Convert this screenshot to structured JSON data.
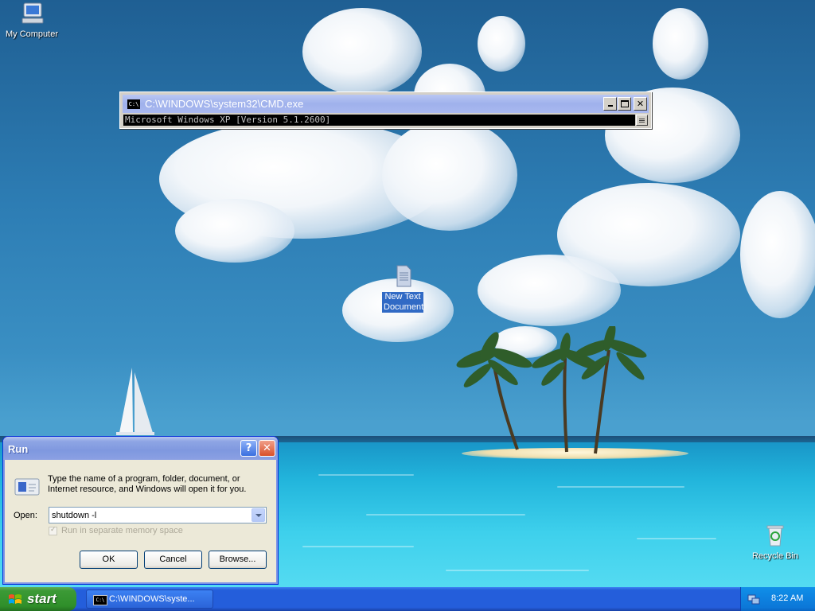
{
  "desktop": {
    "icons": [
      {
        "label": "My Computer",
        "icon": "my-computer-icon"
      },
      {
        "label": "New Text Document",
        "icon": "text-document-icon",
        "selected": true
      },
      {
        "label": "Recycle Bin",
        "icon": "recycle-bin-icon"
      }
    ]
  },
  "cmd_window": {
    "title": "C:\\WINDOWS\\system32\\CMD.exe",
    "console_text": "Microsoft Windows XP [Version 5.1.2600]",
    "icon_text": "C:\\"
  },
  "run_dialog": {
    "title": "Run",
    "description": "Type the name of a program, folder, document, or Internet resource, and Windows will open it for you.",
    "open_label": "Open:",
    "open_value": "shutdown -l",
    "checkbox_label": "Run in separate memory space",
    "checkbox_checked": true,
    "checkbox_enabled": false,
    "ok_label": "OK",
    "cancel_label": "Cancel",
    "browse_label": "Browse...",
    "help_symbol": "?",
    "close_symbol": "✕"
  },
  "taskbar": {
    "start_label": "start",
    "tasks": [
      {
        "label": "C:\\WINDOWS\\syste...",
        "icon": "cmd-icon"
      }
    ],
    "clock": "8:22 AM"
  },
  "colors": {
    "taskbar_blue": "#245edb",
    "start_green": "#3c9a36",
    "selection_blue": "#316ac5",
    "dialog_face": "#ece9d8"
  }
}
